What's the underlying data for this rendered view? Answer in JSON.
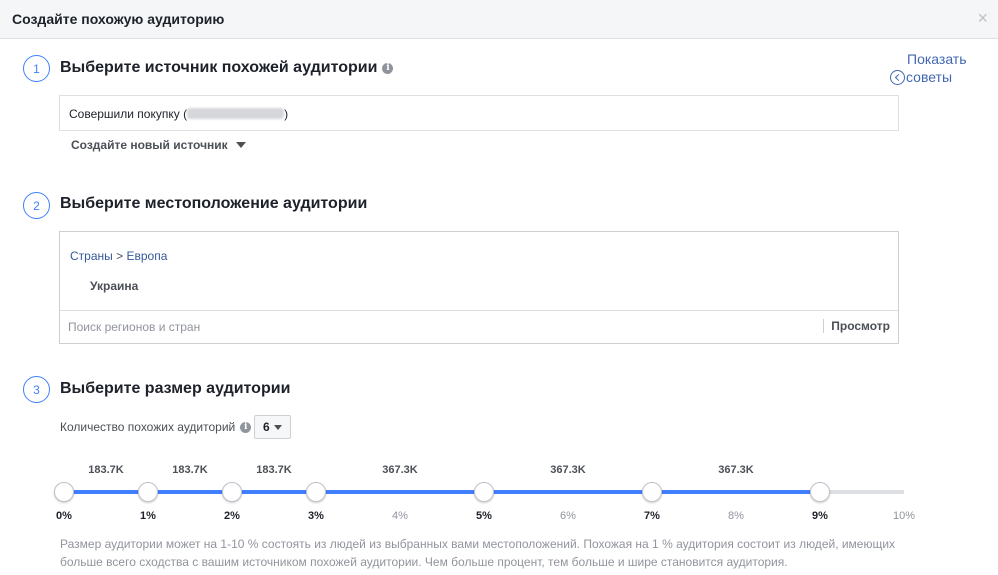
{
  "dialog": {
    "title": "Создайте похожую аудиторию",
    "close_symbol": "×"
  },
  "tips": {
    "line1": "Показать",
    "line2": "советы"
  },
  "step1": {
    "number": "1",
    "title": "Выберите источник похожей аудитории",
    "source_prefix": "Совершили покупку (",
    "source_suffix": ")",
    "new_source_label": "Создайте новый источник"
  },
  "step2": {
    "number": "2",
    "title": "Выберите местоположение аудитории",
    "breadcrumb_root": "Страны",
    "breadcrumb_sep": ">",
    "breadcrumb_leaf": "Европа",
    "country": "Украина",
    "search_placeholder": "Поиск регионов и стран",
    "browse_label": "Просмотр"
  },
  "step3": {
    "number": "3",
    "title": "Выберите размер аудитории",
    "count_label": "Количество похожих аудиторий",
    "count_value": "6",
    "size_labels": [
      "183.7K",
      "183.7K",
      "183.7K",
      "367.3K",
      "367.3K",
      "367.3K"
    ],
    "ticks": [
      "0%",
      "1%",
      "2%",
      "3%",
      "4%",
      "5%",
      "6%",
      "7%",
      "8%",
      "9%",
      "10%"
    ],
    "handle_percents": [
      0,
      1,
      2,
      3,
      5,
      7,
      9
    ],
    "fill_percent": 9,
    "description": "Размер аудитории может на 1-10 % состоять из людей из выбранных вами местоположений. Похожая на 1 % аудитория состоит из людей, имеющих больше всего сходства с вашим источником похожей аудитории. Чем больше процент, тем больше и шире становится аудитория."
  },
  "colors": {
    "accent": "#4080ff",
    "link": "#365899",
    "muted": "#90949c"
  }
}
